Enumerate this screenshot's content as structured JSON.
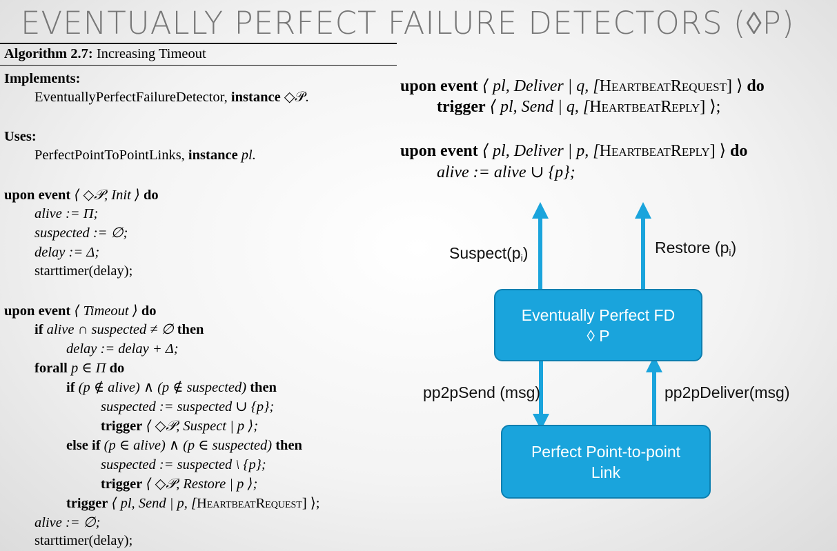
{
  "slide_title": "EVENTUALLY PERFECT FAILURE DETECTORS (◊P)",
  "algorithm": {
    "label": "Algorithm 2.7:",
    "name": "Increasing Timeout"
  },
  "implements": {
    "heading": "Implements:",
    "abstraction": "EventuallyPerfectFailureDetector,",
    "instance_kw": "instance",
    "instance_name": "◇𝒫."
  },
  "uses": {
    "heading": "Uses:",
    "abstraction": "PerfectPointToPointLinks,",
    "instance_kw": "instance",
    "instance_name": "pl."
  },
  "init_block": {
    "upon_event": "upon event",
    "event": "⟨ ◇𝒫, Init ⟩",
    "do": "do",
    "l1": "alive := Π;",
    "l2": "suspected := ∅;",
    "l3": "delay := Δ;",
    "l4": "starttimer(delay);"
  },
  "timeout_block": {
    "upon_event": "upon event",
    "event": "⟨ Timeout ⟩",
    "do": "do",
    "if_kw": "if",
    "if_cond": "alive ∩ suspected ≠ ∅",
    "then_kw": "then",
    "delay_update": "delay := delay + Δ;",
    "forall_kw": "forall",
    "forall_cond": "p ∈ Π",
    "forall_do": "do",
    "if2_kw": "if",
    "if2_cond": "(p ∉ alive) ∧ (p ∉ suspected)",
    "then2_kw": "then",
    "suspect_update": "suspected := suspected ∪ {p};",
    "trigger_kw": "trigger",
    "trigger_suspect": "⟨ ◇𝒫, Suspect | p ⟩;",
    "elseif_kw": "else if",
    "elseif_cond": "(p ∈ alive) ∧ (p ∈ suspected)",
    "then3_kw": "then",
    "restore_update": "suspected := suspected \\ {p};",
    "trigger2_kw": "trigger",
    "trigger_restore": "⟨ ◇𝒫, Restore | p ⟩;",
    "trigger3_kw": "trigger",
    "trigger_hb_pre": "⟨ pl, Send | p, [",
    "trigger_hb_sc": "HeartbeatRequest",
    "trigger_hb_post": "] ⟩;",
    "alive_reset": "alive := ∅;",
    "restart": "starttimer(delay);"
  },
  "right_code": {
    "block1_upon": "upon event",
    "block1_pre": "⟨ pl, Deliver | q, [",
    "block1_sc": "HeartbeatRequest",
    "block1_post": "] ⟩",
    "block1_do": "do",
    "block1_trigger": "trigger",
    "block1_body_pre": "⟨ pl, Send | q, [",
    "block1_body_sc": "HeartbeatReply",
    "block1_body_post": "] ⟩;",
    "block2_upon": "upon event",
    "block2_pre": "⟨ pl, Deliver | p, [",
    "block2_sc": "HeartbeatReply",
    "block2_post": "] ⟩",
    "block2_do": "do",
    "block2_body": "alive := alive ∪ {p};"
  },
  "diagram": {
    "top_box_line1": "Eventually Perfect FD",
    "top_box_line2": "◊ P",
    "bottom_box_line1": "Perfect Point-to-point",
    "bottom_box_line2": "Link",
    "suspect_label": "Suspect(p",
    "suspect_sub": "i",
    "suspect_close": ")",
    "restore_label": "Restore (p",
    "restore_sub": "i",
    "restore_close": ")",
    "send_label": "pp2pSend (msg)",
    "deliver_label": "pp2pDeliver(msg)",
    "box_color": "#1aa4dc",
    "arrow_color": "#1aa4dc"
  }
}
